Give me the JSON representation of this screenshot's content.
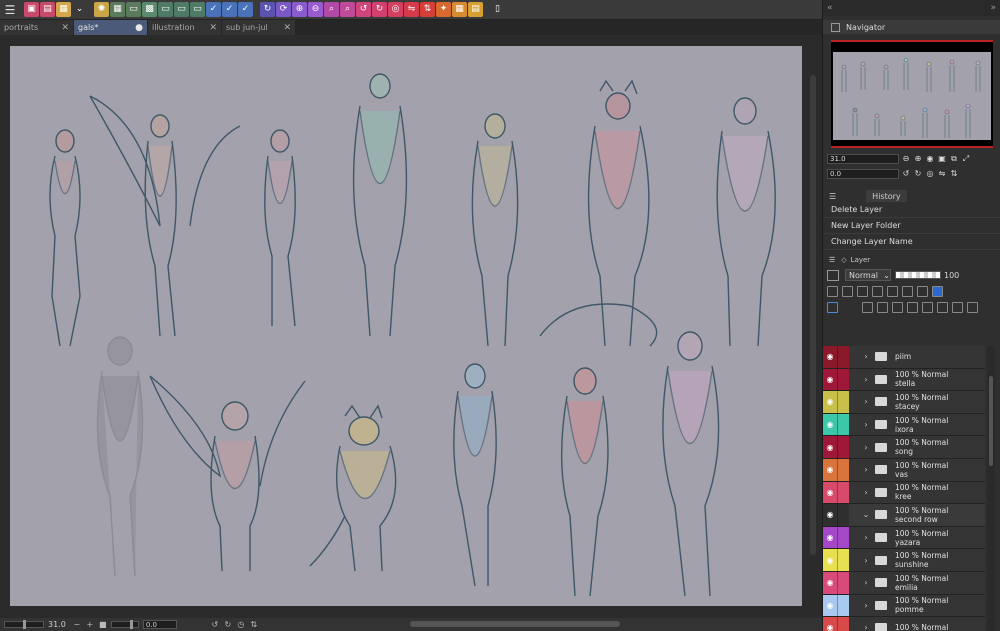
{
  "toolbar": {
    "menu_icon": "hamburger-menu-icon",
    "buttons": [
      {
        "name": "save-icon",
        "color": "#c74a6a",
        "glyph": "▣"
      },
      {
        "name": "export-icon",
        "color": "#c74a6a",
        "glyph": "▤"
      },
      {
        "name": "image-icon",
        "color": "#d4a84a",
        "glyph": "▦"
      },
      {
        "name": "dropdown-icon",
        "color": "#3a3a3a",
        "glyph": "⌄"
      },
      {
        "name": "sun-icon",
        "color": "#c9a545",
        "glyph": "✺"
      },
      {
        "name": "grid-icon",
        "color": "#5c7a5c",
        "glyph": "▦"
      },
      {
        "name": "ruler-icon",
        "color": "#5c7a5c",
        "glyph": "▭"
      },
      {
        "name": "frame-icon",
        "color": "#5c8a6c",
        "glyph": "▩"
      },
      {
        "name": "guide-icon",
        "color": "#4f7a66",
        "glyph": "▭"
      },
      {
        "name": "layout-icon",
        "color": "#4f7a66",
        "glyph": "▭"
      },
      {
        "name": "panel-icon",
        "color": "#4f7a66",
        "glyph": "▭"
      },
      {
        "name": "check-icon",
        "color": "#4a72b8",
        "glyph": "✓"
      },
      {
        "name": "check2-icon",
        "color": "#4a72b8",
        "glyph": "✓"
      },
      {
        "name": "check3-icon",
        "color": "#4a72b8",
        "glyph": "✓"
      },
      {
        "name": "flip-icon",
        "color": "#5a54b0",
        "glyph": "↻"
      },
      {
        "name": "rotate-icon",
        "color": "#7a58c8",
        "glyph": "⟳"
      },
      {
        "name": "zoom-in-icon",
        "color": "#8a5acf",
        "glyph": "⊕"
      },
      {
        "name": "zoom-out-icon",
        "color": "#9a5acf",
        "glyph": "⊖"
      },
      {
        "name": "zoom-fit-icon",
        "color": "#b24aa8",
        "glyph": "⌕"
      },
      {
        "name": "zoom-actual-icon",
        "color": "#c04a9a",
        "glyph": "⌕"
      },
      {
        "name": "rotate-left-icon",
        "color": "#d0457a",
        "glyph": "↺"
      },
      {
        "name": "rotate-right-icon",
        "color": "#d24070",
        "glyph": "↻"
      },
      {
        "name": "reset-rotation-icon",
        "color": "#d44060",
        "glyph": "◎"
      },
      {
        "name": "flip-h-icon",
        "color": "#d43a4a",
        "glyph": "⇋"
      },
      {
        "name": "flip-v-icon",
        "color": "#d44038",
        "glyph": "⇅"
      },
      {
        "name": "transform-icon",
        "color": "#d86a30",
        "glyph": "✦"
      },
      {
        "name": "mesh-icon",
        "color": "#d88a30",
        "glyph": "▦"
      },
      {
        "name": "note-icon",
        "color": "#d8a030",
        "glyph": "▤"
      },
      {
        "name": "phone-icon",
        "color": "#3a3a3a",
        "glyph": "▯"
      }
    ]
  },
  "tabs": [
    {
      "label": "portraits",
      "close": "✕",
      "active": false
    },
    {
      "label": "gals*",
      "close": "●",
      "active": true
    },
    {
      "label": "illustration",
      "close": "✕",
      "active": false
    },
    {
      "label": "sub jun-jul",
      "close": "✕",
      "active": false
    }
  ],
  "status": {
    "zoom": "31.0",
    "rotation": "0.0"
  },
  "navigator": {
    "title": "Navigator",
    "zoom": "31.0",
    "rotation": "0.0"
  },
  "history": {
    "tab_label": "History",
    "items": [
      "Delete Layer",
      "New Layer Folder",
      "Change Layer Name"
    ]
  },
  "layer_panel": {
    "tab_label": "Layer",
    "blend_mode": "Normal",
    "opacity": "100"
  },
  "layers": [
    {
      "mode": "",
      "name": "piim",
      "color": "#8a1a2a",
      "folder_open": false
    },
    {
      "mode": "100 % Normal",
      "name": "stella",
      "color": "#a01838",
      "folder_open": false
    },
    {
      "mode": "100 % Normal",
      "name": "stacey",
      "color": "#c8c048",
      "folder_open": false
    },
    {
      "mode": "100 % Normal",
      "name": "ixora",
      "color": "#3cc8a8",
      "folder_open": false
    },
    {
      "mode": "100 % Normal",
      "name": "song",
      "color": "#a01838",
      "folder_open": false
    },
    {
      "mode": "100 % Normal",
      "name": "vas",
      "color": "#d8743c",
      "folder_open": false
    },
    {
      "mode": "100 % Normal",
      "name": "kree",
      "color": "#d84a6a",
      "folder_open": false
    },
    {
      "mode": "100 % Normal",
      "name": "second row",
      "color": "#2f2f2f",
      "folder_open": true
    },
    {
      "mode": "100 % Normal",
      "name": "yazara",
      "color": "#a448c8",
      "folder_open": false
    },
    {
      "mode": "100 % Normal",
      "name": "sunshine",
      "color": "#e8e050",
      "folder_open": false
    },
    {
      "mode": "100 % Normal",
      "name": "emilia",
      "color": "#d84a7a",
      "folder_open": false
    },
    {
      "mode": "100 % Normal",
      "name": "pomme",
      "color": "#a8c8f0",
      "folder_open": false
    },
    {
      "mode": "100 % Normal",
      "name": "",
      "color": "#d84a4a",
      "folder_open": false
    }
  ]
}
